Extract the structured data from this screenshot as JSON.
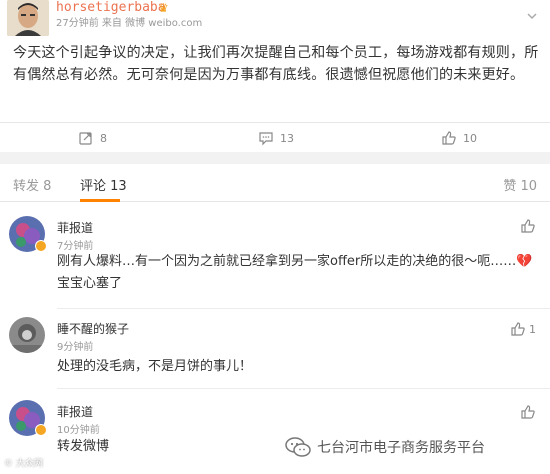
{
  "post": {
    "username": "horsetigerbaba",
    "vip_icon": "crown-icon",
    "meta": "27分钟前  来自 微博 weibo.com",
    "text": "今天这个引起争议的决定，让我们再次提醒自己和每个员工，每场游戏都有规则，所有偶然总有必然。无可奈何是因为万事都有底线。很遗憾但祝愿他们的未来更好。",
    "actions": {
      "repost_count": "8",
      "comment_count": "13",
      "like_count": "10"
    }
  },
  "tabs": {
    "repost": "转发 8",
    "comment": "评论 13",
    "like": "赞 10"
  },
  "comments": [
    {
      "name": "菲报道",
      "time": "7分钟前",
      "text_main": "刚有人爆料…有一个因为之前就已经拿到另一家offer所以走的决绝的很～呃……",
      "text_emoji": "💔",
      "text_tail": "宝宝心塞了",
      "likes": ""
    },
    {
      "name": "睡不醒的猴子",
      "time": "9分钟前",
      "text": "处理的没毛病，不是月饼的事儿！",
      "likes": "1"
    },
    {
      "name": "菲报道",
      "time": "10分钟前",
      "text": "转发微博",
      "likes": ""
    }
  ],
  "watermarks": {
    "left": "© 大众网",
    "right": "七台河市电子商务服务平台"
  },
  "colors": {
    "accent": "#ff8200",
    "username": "#eb7350",
    "badge": "#f5a623"
  }
}
